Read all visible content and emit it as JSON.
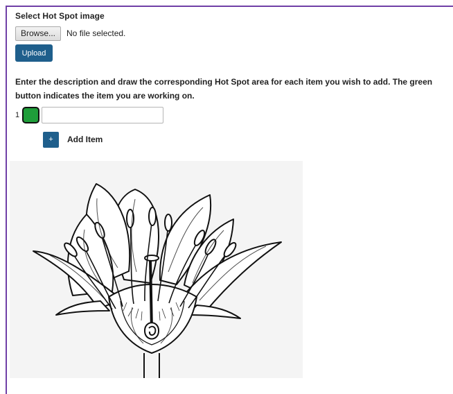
{
  "form": {
    "title": "Select Hot Spot image",
    "browse_label": "Browse...",
    "file_status": "No file selected.",
    "upload_label": "Upload",
    "instructions": "Enter the description and draw the corresponding Hot Spot area for each item you wish to add. The green button indicates the item you are working on."
  },
  "items": [
    {
      "number": "1",
      "value": "",
      "color": "#1f9e3a"
    }
  ],
  "add_item": {
    "icon": "plus-icon",
    "icon_glyph": "+",
    "label": "Add Item"
  },
  "colors": {
    "frame": "#6f3fa6",
    "primary_button": "#1f5f8c",
    "active_item": "#1f9e3a"
  }
}
